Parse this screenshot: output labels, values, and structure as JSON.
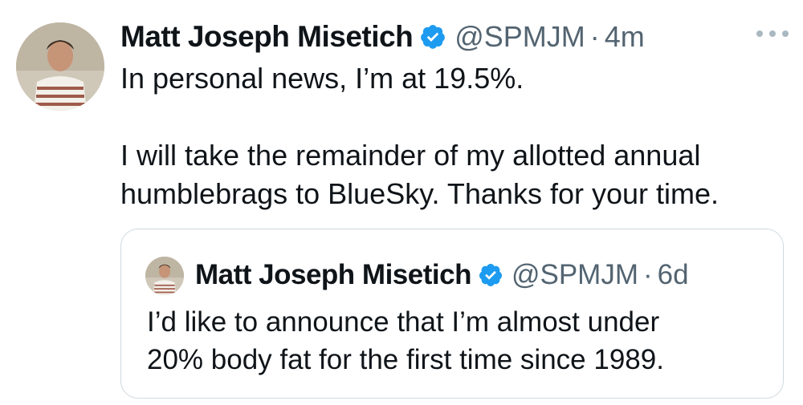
{
  "tweet": {
    "author_name": "Matt Joseph Misetich",
    "handle": "@SPMJM",
    "separator": "·",
    "time": "4m",
    "more_icon": "more-horizontal-icon",
    "text_line1": "In personal news, I’m at 19.5%.",
    "text_line2": "I will take the remainder of my allotted annual",
    "text_line3": "humblebrags to BlueSky. Thanks for your time."
  },
  "quoted_tweet": {
    "author_name": "Matt Joseph Misetich",
    "handle": "@SPMJM",
    "separator": "·",
    "time": "6d",
    "text_line1": "I’d like to announce that I’m almost under",
    "text_line2": "20% body fat for the first time since 1989."
  },
  "colors": {
    "verified_blue": "#1d9bf0",
    "secondary_text": "#536471",
    "border": "#cfd9de"
  }
}
